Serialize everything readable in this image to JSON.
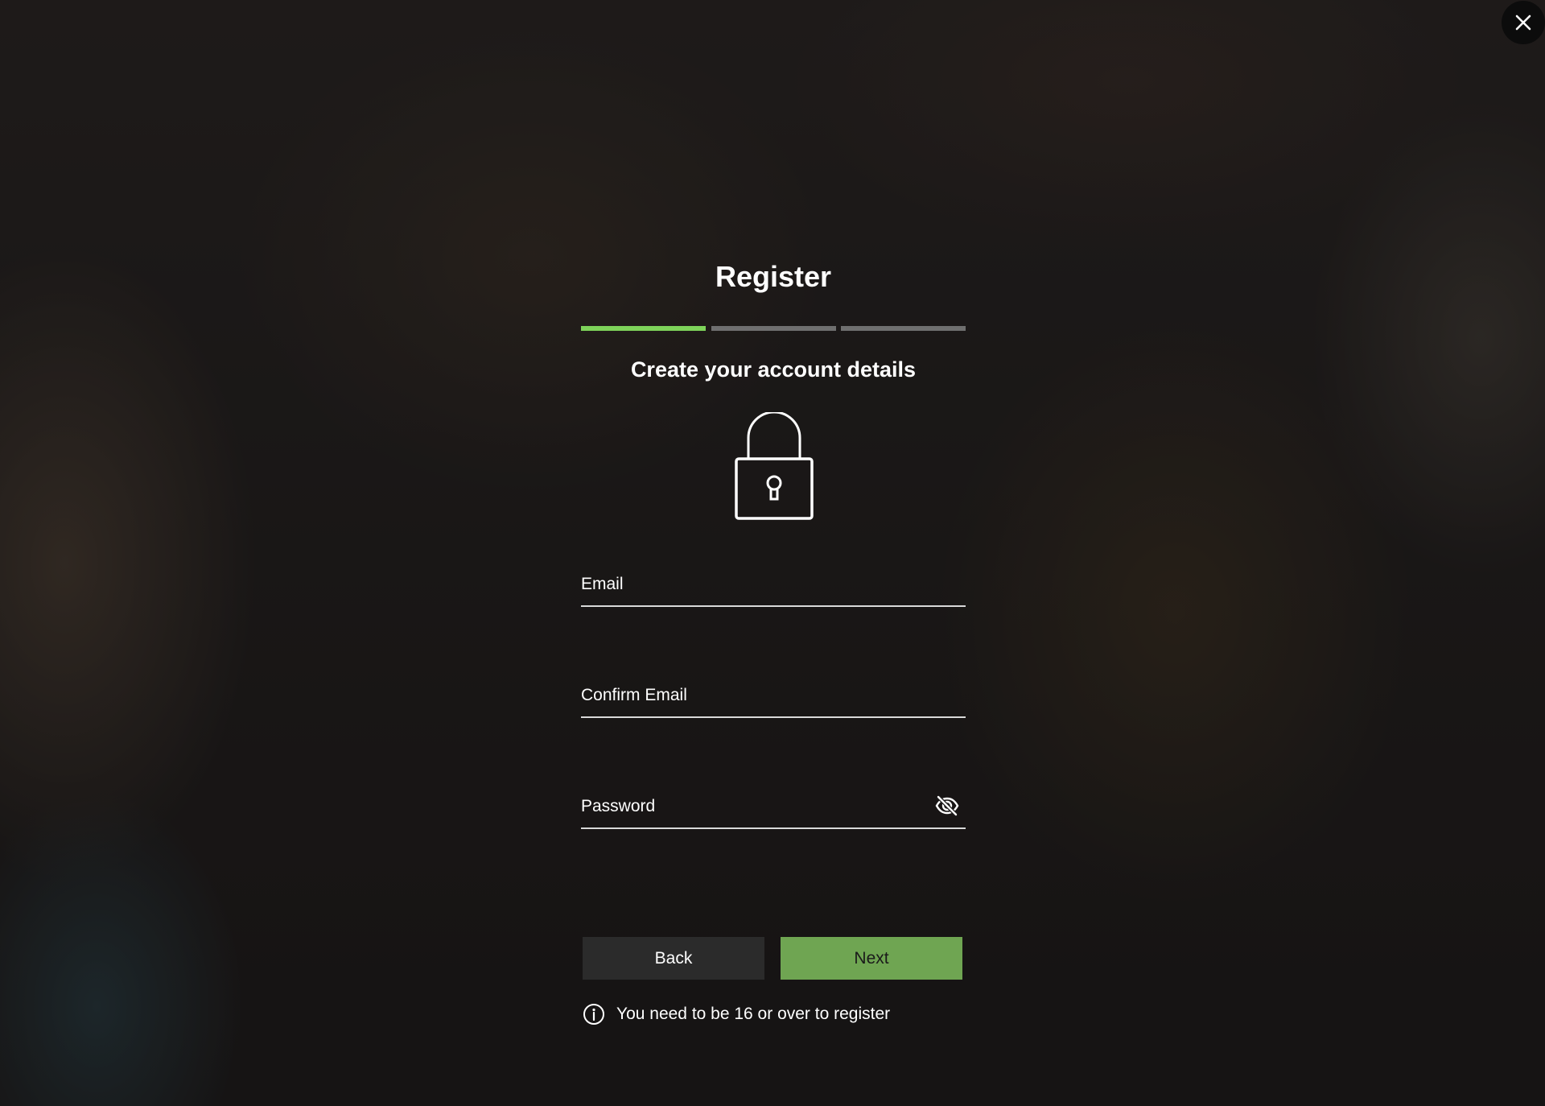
{
  "dialog": {
    "title": "Register",
    "subtitle": "Create your account details",
    "progress": {
      "current_step": 1,
      "total_steps": 3
    },
    "icon": "padlock-icon"
  },
  "form": {
    "email": {
      "label": "Email",
      "value": ""
    },
    "confirm_email": {
      "label": "Confirm Email",
      "value": ""
    },
    "password": {
      "label": "Password",
      "value": "",
      "toggle_icon": "eye-slash-icon"
    }
  },
  "buttons": {
    "back_label": "Back",
    "next_label": "Next"
  },
  "notice": {
    "icon": "info-icon",
    "text": "You need to be 16 or over to register"
  },
  "close": {
    "icon": "close-icon"
  },
  "colors": {
    "accent": "#7ed35a",
    "next_button": "#6fa552",
    "back_button": "#2b2b2b",
    "progress_inactive": "#6f6f6f"
  }
}
